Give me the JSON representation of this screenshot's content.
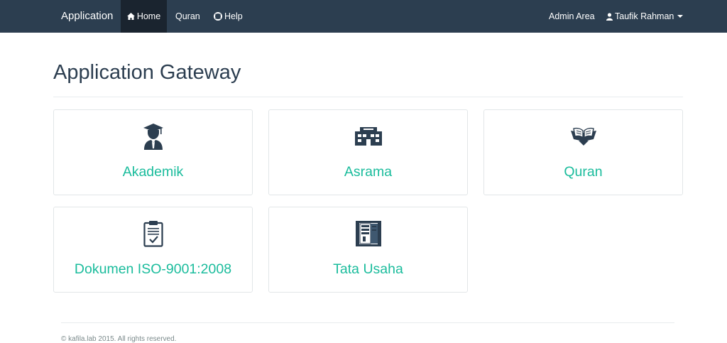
{
  "navbar": {
    "brand": "Application",
    "items": [
      {
        "label": "Home",
        "icon": "home-icon",
        "active": true
      },
      {
        "label": "Quran",
        "icon": "",
        "active": false
      },
      {
        "label": "Help",
        "icon": "lifebuoy-icon",
        "active": false
      }
    ],
    "right": {
      "admin": "Admin Area",
      "user": "Taufik Rahman",
      "user_icon": "user-icon"
    }
  },
  "page": {
    "title": "Application Gateway"
  },
  "apps": [
    {
      "label": "Akademik",
      "icon": "graduate-icon"
    },
    {
      "label": "Asrama",
      "icon": "building-icon"
    },
    {
      "label": "Quran",
      "icon": "open-book-icon"
    },
    {
      "label": "Dokumen ISO-9001:2008",
      "icon": "clipboard-check-icon"
    },
    {
      "label": "Tata Usaha",
      "icon": "office-cabinet-icon"
    }
  ],
  "footer": {
    "text": "© kafila.lab 2015. All rights reserved."
  },
  "colors": {
    "navbar_bg": "#2c3e50",
    "navbar_active": "#1a242f",
    "accent": "#1abc9c",
    "text_dark": "#2c3e50",
    "muted": "#7b8a8b"
  }
}
